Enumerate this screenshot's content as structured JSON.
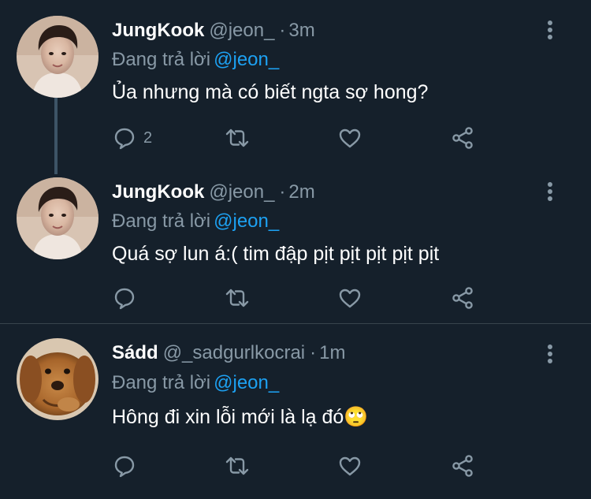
{
  "tweets": [
    {
      "name": "JungKook",
      "handle": "@jeon_",
      "separator": "·",
      "time": "3m",
      "reply_prefix": "Đang trả lời",
      "reply_to": "@jeon_",
      "text": "Ủa nhưng mà có biết ngta sợ hong?",
      "reply_count": "2"
    },
    {
      "name": "JungKook",
      "handle": "@jeon_",
      "separator": "·",
      "time": "2m",
      "reply_prefix": "Đang trả lời",
      "reply_to": "@jeon_",
      "text": "Quá sợ lun á:( tim đập pịt pịt pịt pịt pịt",
      "reply_count": ""
    },
    {
      "name": "Sádd",
      "handle": "@_sadgurlkocrai",
      "separator": "·",
      "time": "1m",
      "reply_prefix": "Đang trả lời",
      "reply_to": "@jeon_",
      "text": "Hông đi xin lỗi mới là lạ đó🙄",
      "reply_count": ""
    }
  ],
  "icons": {
    "reply": "reply-icon",
    "retweet": "retweet-icon",
    "like": "heart-icon",
    "share": "share-icon",
    "more": "more-options-icon"
  },
  "colors": {
    "background": "#15202b",
    "muted": "#8899a6",
    "accent": "#1da1f2",
    "divider": "#38444d",
    "thread_line": "#3d5466"
  }
}
